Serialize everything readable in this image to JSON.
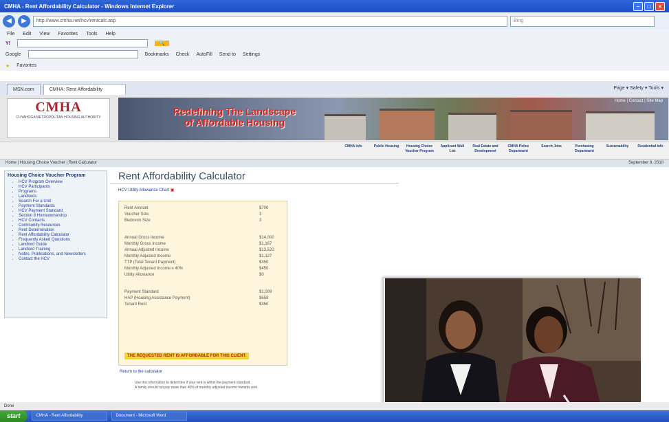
{
  "browser": {
    "title": "CMHA - Rent Affordability Calculator - Windows Internet Explorer",
    "url": "http://www.cmha.net/hcv/rentcalc.asp",
    "search_placeholder": "Bing",
    "menu": [
      "File",
      "Edit",
      "View",
      "Favorites",
      "Tools",
      "Help"
    ],
    "toolbar_google": "Google",
    "toolbar_links": [
      "Bookmarks",
      "Check",
      "AutoFill",
      "Send to",
      "Settings"
    ],
    "favorites_label": "Favorites",
    "tabs": [
      "MSN.com",
      "CMHA: Rent Affordability"
    ],
    "tab_tools": "Page ▾  Safety ▾  Tools ▾"
  },
  "site": {
    "logo_text": "CMHA",
    "logo_sub": "CUYAHOGA METROPOLITAN HOUSING AUTHORITY",
    "hero_line1": "Redefining The Landscape",
    "hero_line2": "of Affordable Housing",
    "util_links": "Home | Contact | Site Map",
    "nav": [
      "CMHA Info",
      "Public Housing",
      "Housing Choice Voucher Program",
      "Applicant Wait List",
      "Real Estate and Development",
      "CMHA Police Department",
      "Search Jobs",
      "Purchasing Department",
      "Sustainability",
      "Residential Info"
    ],
    "breadcrumb": "Home | Housing Choice Voucher | Rent Calculator",
    "date": "September 8, 2010"
  },
  "sidebar": {
    "heading": "Housing Choice Voucher Program",
    "items": [
      "HCV Program Overview",
      "HCV Participants",
      "Programs",
      "Landlords",
      "Search For a Unit",
      "Payment Standards",
      "HCV Payment Standard",
      "Section 8 Homeownership",
      "HCV Contacts",
      "Community Resources",
      "Rent Determination",
      "Rent Affordability Calculator",
      "Frequently Asked Questions",
      "Landlord Guide",
      "Landlord Training",
      "Notes, Publications, and Newsletters",
      "Contact the HCV"
    ]
  },
  "main": {
    "title": "Rent Affordability Calculator",
    "chart_link": "HCV Utility Allowance Chart",
    "rows": [
      {
        "label": "Rent Amount",
        "value": "$700"
      },
      {
        "label": "Voucher Size",
        "value": "3"
      },
      {
        "label": "Bedroom Size",
        "value": "3"
      },
      {
        "label": "Annual Gross Income",
        "value": "$14,000"
      },
      {
        "label": "Monthly Gross Income",
        "value": "$1,167"
      },
      {
        "label": "Annual Adjusted Income",
        "value": "$13,520"
      },
      {
        "label": "Monthly Adjusted Income",
        "value": "$1,127"
      },
      {
        "label": "TTP (Total Tenant Payment)",
        "value": "$350"
      },
      {
        "label": "Monthly Adjusted Income x 40%",
        "value": "$450"
      },
      {
        "label": "Utility Allowance",
        "value": "$0"
      },
      {
        "label": "Payment Standard",
        "value": "$1,009"
      },
      {
        "label": "HAP (Housing Assistance Payment)",
        "value": "$659"
      },
      {
        "label": "Tenant Rent",
        "value": "$350"
      }
    ],
    "verdict": "THE REQUESTED RENT IS AFFORDABLE FOR THIS CLIENT.",
    "return_link": "Return to the calculator",
    "notes": [
      "Use this information to determine if your rent is within the payment standard.",
      "A family should not pay more than 40% of monthly adjusted income towards rent."
    ]
  },
  "status": {
    "text": "Done",
    "start": "start",
    "tasks": [
      "CMHA - Rent Affordability",
      "Document - Microsoft Word"
    ]
  },
  "colors": {
    "brand_red": "#b01e2e",
    "title_blue": "#2f66d8",
    "verdict_yellow": "#f4d63a"
  }
}
